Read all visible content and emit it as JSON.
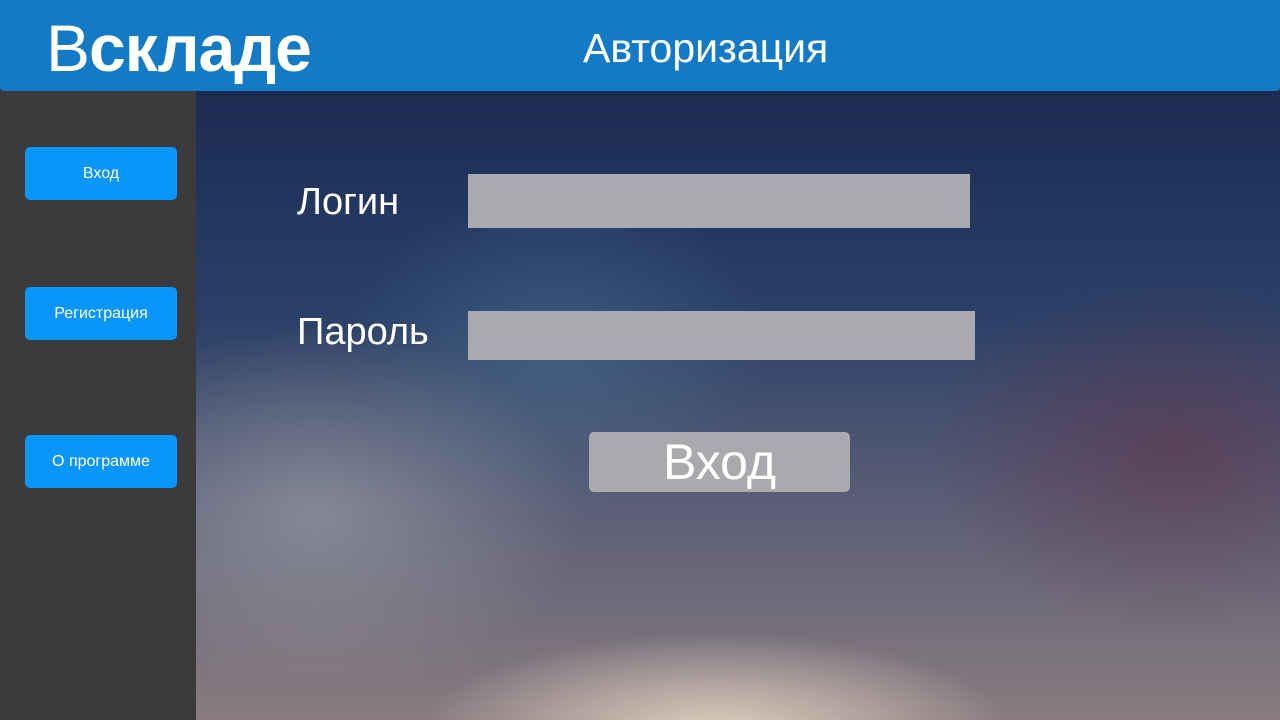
{
  "app": {
    "logo_prefix": "В",
    "logo_suffix": "складе",
    "page_title": "Авторизация",
    "accent_color": "#157ac6"
  },
  "sidebar": {
    "items": [
      {
        "label": "Вход"
      },
      {
        "label": "Регистрация"
      },
      {
        "label": "О программе"
      }
    ],
    "button_color": "#0a95fb"
  },
  "form": {
    "login_label": "Логин",
    "login_value": "",
    "password_label": "Пароль",
    "password_value": "",
    "submit_label": "Вход",
    "field_color": "#a9aaad"
  }
}
